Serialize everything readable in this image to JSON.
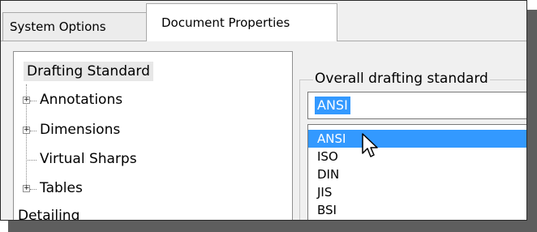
{
  "tabs": [
    {
      "label": "System Options",
      "active": false
    },
    {
      "label": "Document Properties",
      "active": true
    }
  ],
  "tree": {
    "items": [
      {
        "label": "Drafting Standard",
        "expandable": false,
        "selected": true
      },
      {
        "label": "Annotations",
        "expandable": true
      },
      {
        "label": "Dimensions",
        "expandable": true
      },
      {
        "label": "Virtual Sharps",
        "expandable": false
      },
      {
        "label": "Tables",
        "expandable": true
      },
      {
        "label": "Detailing",
        "expandable": false
      }
    ]
  },
  "drafting": {
    "group_label": "Overall drafting standard",
    "current_value": "ANSI",
    "options": [
      "ANSI",
      "ISO",
      "DIN",
      "JIS",
      "BSI"
    ],
    "highlighted_option": "ANSI"
  },
  "icons": {
    "expand": "plus-box-icon",
    "cursor": "mouse-pointer-icon"
  },
  "colors": {
    "selection": "#3399ff",
    "window_bg": "#f0f0f0"
  }
}
